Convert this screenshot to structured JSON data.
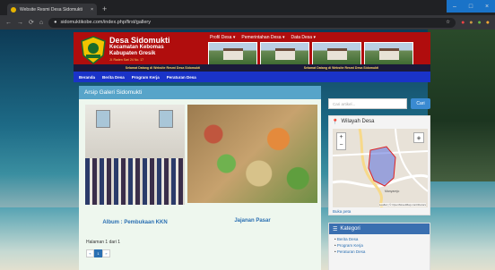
{
  "browser": {
    "tab_title": "Website Resmi Desa Sidomukti",
    "new_tab": "+",
    "url": "sidomuktikobe.com/index.php/first/gallery"
  },
  "header": {
    "title": "Desa Sidomukti",
    "subtitle1": "Kecamatan Kebomas",
    "subtitle2": "Kabupaten Gresik",
    "address": "Jl. Raden Sari 24 No. 17",
    "top_menu": [
      "Profil Desa",
      "Pemerintahan Desa",
      "Data Desa"
    ],
    "marquee": [
      "Selamat Datang di Website Resmi Desa Sidomukti",
      "Selamat Datang di Website Resmi Desa Sidomukti"
    ]
  },
  "nav": [
    "Beranda",
    "Berita Desa",
    "Program Kerja",
    "Peraturan Desa"
  ],
  "gallery": {
    "heading": "Arsip Galeri Sidomukti",
    "items": [
      {
        "caption": "Album : Pembukaan KKN"
      },
      {
        "caption": "Jajanan Pasar"
      }
    ],
    "page_info": "Halaman 1 dari 1",
    "pager": [
      "«",
      "1",
      "»"
    ]
  },
  "sidebar": {
    "search_placeholder": "Cari artikel...",
    "search_button": "Cari",
    "map_heading": "Wilayah Desa",
    "map_label": "Manyarejo",
    "map_attribution": "Leaflet | © OpenStreetMap contributors",
    "map_link": "Buka peta",
    "category_heading": "Kategori",
    "categories": [
      "Berita Desa",
      "Program Kerja",
      "Peraturan Desa"
    ]
  }
}
